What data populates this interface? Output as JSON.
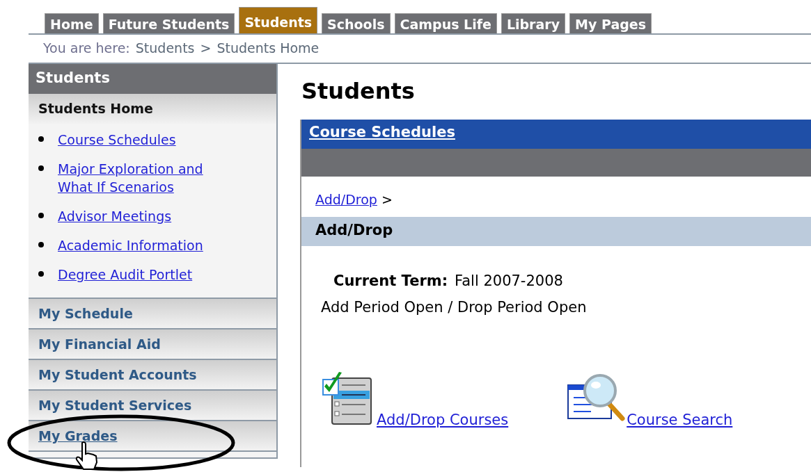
{
  "tabs": [
    {
      "label": "Home",
      "selected": false
    },
    {
      "label": "Future Students",
      "selected": false
    },
    {
      "label": "Students",
      "selected": true
    },
    {
      "label": "Schools",
      "selected": false
    },
    {
      "label": "Campus Life",
      "selected": false
    },
    {
      "label": "Library",
      "selected": false
    },
    {
      "label": "My Pages",
      "selected": false
    }
  ],
  "breadcrumb": {
    "prefix": "You are here:",
    "items": [
      "Students",
      "Students Home"
    ],
    "separator": ">"
  },
  "sidebar": {
    "title": "Students",
    "sections": [
      {
        "label": "Students Home",
        "expanded": true,
        "hovered": false,
        "links": [
          "Course Schedules",
          "Major Exploration and What If Scenarios",
          "Advisor Meetings",
          "Academic Information",
          "Degree Audit Portlet"
        ]
      },
      {
        "label": "My Schedule",
        "expanded": false,
        "hovered": false
      },
      {
        "label": "My Financial Aid",
        "expanded": false,
        "hovered": false
      },
      {
        "label": "My Student Accounts",
        "expanded": false,
        "hovered": false
      },
      {
        "label": "My Student Services",
        "expanded": false,
        "hovered": false
      },
      {
        "label": "My Grades",
        "expanded": false,
        "hovered": true
      }
    ]
  },
  "main": {
    "heading": "Students",
    "panel": {
      "title": "Course Schedules",
      "crumb": {
        "link": "Add/Drop",
        "separator": ">"
      },
      "section_title": "Add/Drop",
      "term_label": "Current Term:",
      "term_value": "Fall 2007-2008",
      "status": "Add Period Open / Drop Period Open",
      "actions": [
        {
          "kind": "checklist",
          "label": "Add/Drop Courses"
        },
        {
          "kind": "search",
          "label": "Course Search"
        }
      ]
    }
  }
}
